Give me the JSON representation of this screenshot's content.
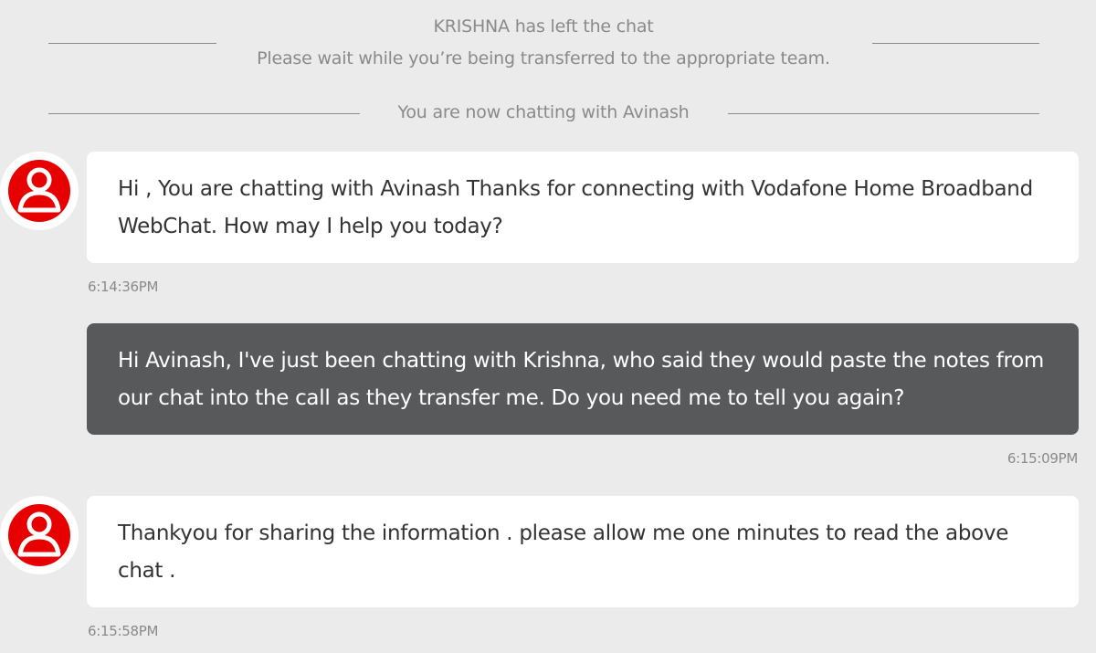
{
  "system_messages": {
    "left_chat": "KRISHNA has left the chat",
    "transfer_wait": "Please wait while you’re being transferred to the appropriate team.",
    "now_chatting": "You are now chatting with Avinash"
  },
  "messages": [
    {
      "sender": "agent",
      "text": "Hi , You are chatting with Avinash Thanks for connecting with Vodafone Home Broadband WebChat. How may I help you today?",
      "time": "6:14:36PM"
    },
    {
      "sender": "user",
      "text": "Hi Avinash, I've just been chatting with Krishna, who said they would paste the notes from our chat into the call as they transfer me. Do you need me to tell you again?",
      "time": "6:15:09PM"
    },
    {
      "sender": "agent",
      "text": "Thankyou for sharing the information . please allow me one minutes to read the above chat .",
      "time": "6:15:58PM"
    }
  ],
  "colors": {
    "brand_red": "#e60000",
    "page_bg": "#ebebeb",
    "agent_bubble": "#ffffff",
    "user_bubble": "#58595b",
    "muted_text": "#8a8a8a"
  },
  "icons": {
    "agent_avatar": "user-silhouette-icon"
  }
}
